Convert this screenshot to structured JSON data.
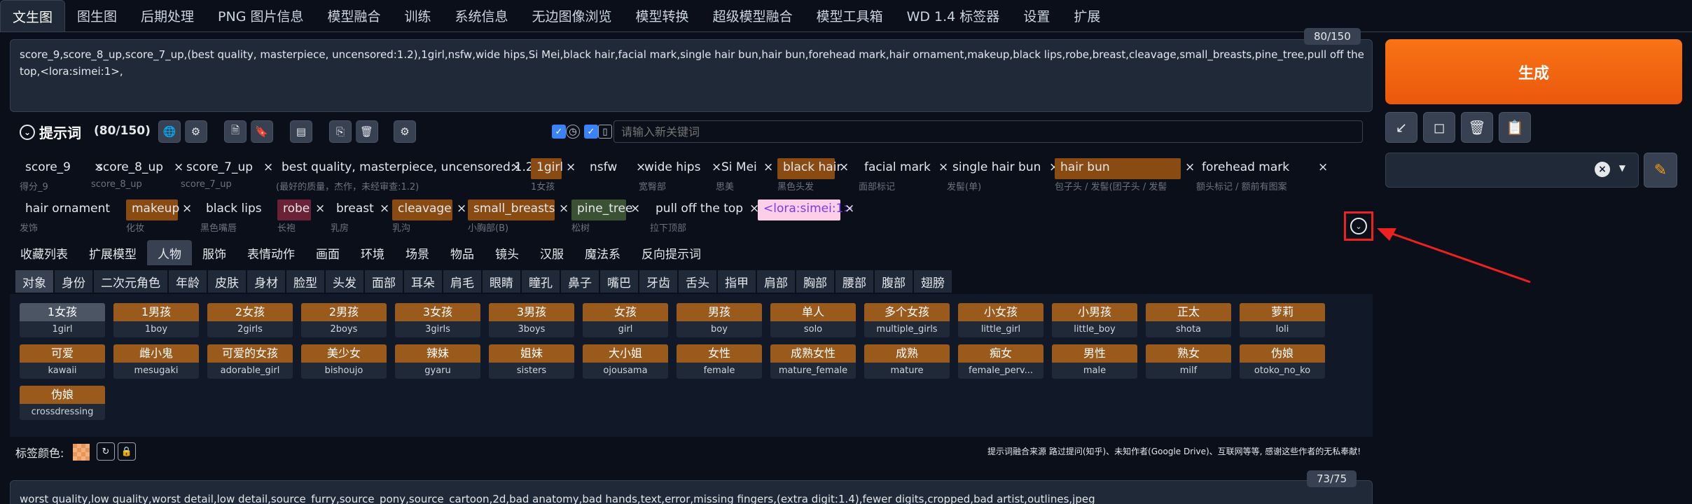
{
  "tabs": [
    "文生图",
    "图生图",
    "后期处理",
    "PNG 图片信息",
    "模型融合",
    "训练",
    "系统信息",
    "无边图像浏览",
    "模型转换",
    "超级模型融合",
    "模型工具箱",
    "WD 1.4 标签器",
    "设置",
    "扩展"
  ],
  "prompt": {
    "text": "score_9,score_8_up,score_7_up,(best quality, masterpiece, uncensored:1.2),1girl,nsfw,wide hips,Si Mei,black hair,facial mark,single hair bun,hair bun,forehead mark,hair ornament,makeup,black lips,robe,breast,cleavage,small_breasts,pine_tree,pull off the top,<lora:simei:1>,",
    "counter": "80/150"
  },
  "generate_label": "生成",
  "tool_icons": [
    "arrow-icon",
    "square-icon",
    "trash-icon",
    "clipboard-icon"
  ],
  "tag_header": {
    "title": "提示词",
    "count": "(80/150)",
    "keyword_placeholder": "请输入新关键词"
  },
  "tags": [
    {
      "text": "score_9",
      "sub": "得分_9",
      "color": "none"
    },
    {
      "text": "score_8_up",
      "sub": "score_8_up",
      "color": "none"
    },
    {
      "text": "score_7_up",
      "sub": "score_7_up",
      "color": "none"
    },
    {
      "text": "best quality, masterpiece, uncensored:1.2",
      "sub": "(最好的质量，杰作，未经审查:1.2)",
      "color": "none"
    },
    {
      "text": "1girl",
      "sub": "1女孩",
      "color": "orange"
    },
    {
      "text": "nsfw",
      "sub": "",
      "color": "none"
    },
    {
      "text": "wide hips",
      "sub": "宽臀部",
      "color": "none"
    },
    {
      "text": "Si Mei",
      "sub": "思美",
      "color": "none"
    },
    {
      "text": "black hair",
      "sub": "黑色头发",
      "color": "orange"
    },
    {
      "text": "facial mark",
      "sub": "面部标记",
      "color": "none"
    },
    {
      "text": "single hair bun",
      "sub": "发髻(单)",
      "color": "none"
    },
    {
      "text": "hair bun",
      "sub": "包子头 / 发髻(团子头 / 发髻",
      "color": "orange"
    },
    {
      "text": "forehead mark",
      "sub": "额头标记 / 额前有图案",
      "color": "none"
    },
    {
      "text": "hair ornament",
      "sub": "发饰",
      "color": "none"
    },
    {
      "text": "makeup",
      "sub": "化妆",
      "color": "orange"
    },
    {
      "text": "black lips",
      "sub": "黑色嘴唇",
      "color": "none"
    },
    {
      "text": "robe",
      "sub": "长袍",
      "color": "red"
    },
    {
      "text": "breast",
      "sub": "乳房",
      "color": "none"
    },
    {
      "text": "cleavage",
      "sub": "乳沟",
      "color": "orange"
    },
    {
      "text": "small_breasts",
      "sub": "小胸部(B)",
      "color": "orange"
    },
    {
      "text": "pine_tree",
      "sub": "松树",
      "color": "green"
    },
    {
      "text": "pull off the top",
      "sub": "拉下顶部",
      "color": "none"
    },
    {
      "text": "<lora:simei:1>",
      "sub": "",
      "color": "pink"
    }
  ],
  "categories": [
    "收藏列表",
    "扩展模型",
    "人物",
    "服饰",
    "表情动作",
    "画面",
    "环境",
    "场景",
    "物品",
    "镜头",
    "汉服",
    "魔法系",
    "反向提示词"
  ],
  "active_category": "人物",
  "subcategories": [
    "对象",
    "身份",
    "二次元角色",
    "年龄",
    "皮肤",
    "身材",
    "脸型",
    "头发",
    "面部",
    "耳朵",
    "肩毛",
    "眼睛",
    "瞳孔",
    "鼻子",
    "嘴巴",
    "牙齿",
    "舌头",
    "指甲",
    "肩部",
    "胸部",
    "腰部",
    "腹部",
    "翅膀"
  ],
  "active_subcategory": "对象",
  "cards": [
    {
      "cn": "1女孩",
      "en": "1girl"
    },
    {
      "cn": "1男孩",
      "en": "1boy"
    },
    {
      "cn": "2女孩",
      "en": "2girls"
    },
    {
      "cn": "2男孩",
      "en": "2boys"
    },
    {
      "cn": "3女孩",
      "en": "3girls"
    },
    {
      "cn": "3男孩",
      "en": "3boys"
    },
    {
      "cn": "女孩",
      "en": "girl"
    },
    {
      "cn": "男孩",
      "en": "boy"
    },
    {
      "cn": "单人",
      "en": "solo"
    },
    {
      "cn": "多个女孩",
      "en": "multiple_girls"
    },
    {
      "cn": "小女孩",
      "en": "little_girl"
    },
    {
      "cn": "小男孩",
      "en": "little_boy"
    },
    {
      "cn": "正太",
      "en": "shota"
    },
    {
      "cn": "萝莉",
      "en": "loli"
    },
    {
      "cn": "可爱",
      "en": "kawaii"
    },
    {
      "cn": "雌小鬼",
      "en": "mesugaki"
    },
    {
      "cn": "可爱的女孩",
      "en": "adorable_girl"
    },
    {
      "cn": "美少女",
      "en": "bishoujo"
    },
    {
      "cn": "辣妹",
      "en": "gyaru"
    },
    {
      "cn": "姐妹",
      "en": "sisters"
    },
    {
      "cn": "大小姐",
      "en": "ojousama"
    },
    {
      "cn": "女性",
      "en": "female"
    },
    {
      "cn": "成熟女性",
      "en": "mature_female"
    },
    {
      "cn": "成熟",
      "en": "mature"
    },
    {
      "cn": "痴女",
      "en": "female_perv..."
    },
    {
      "cn": "男性",
      "en": "male"
    },
    {
      "cn": "熟女",
      "en": "milf"
    },
    {
      "cn": "伪娘",
      "en": "otoko_no_ko"
    },
    {
      "cn": "伪娘",
      "en": "crossdressing"
    }
  ],
  "footer": {
    "color_label": "标签颜色:",
    "credit": "提示词融合来源 路过提问(知乎)、未知作者(Google Drive)、互联网等等, 感谢这些作者的无私奉献!"
  },
  "negative_prompt": {
    "text": "worst quality,low quality,worst detail,low detail,source_furry,source_pony,source_cartoon,2d,bad anatomy,bad hands,text,error,missing fingers,(extra digit:1.4),fewer digits,cropped,bad artist,outlines,jpeg",
    "counter": "73/75"
  }
}
